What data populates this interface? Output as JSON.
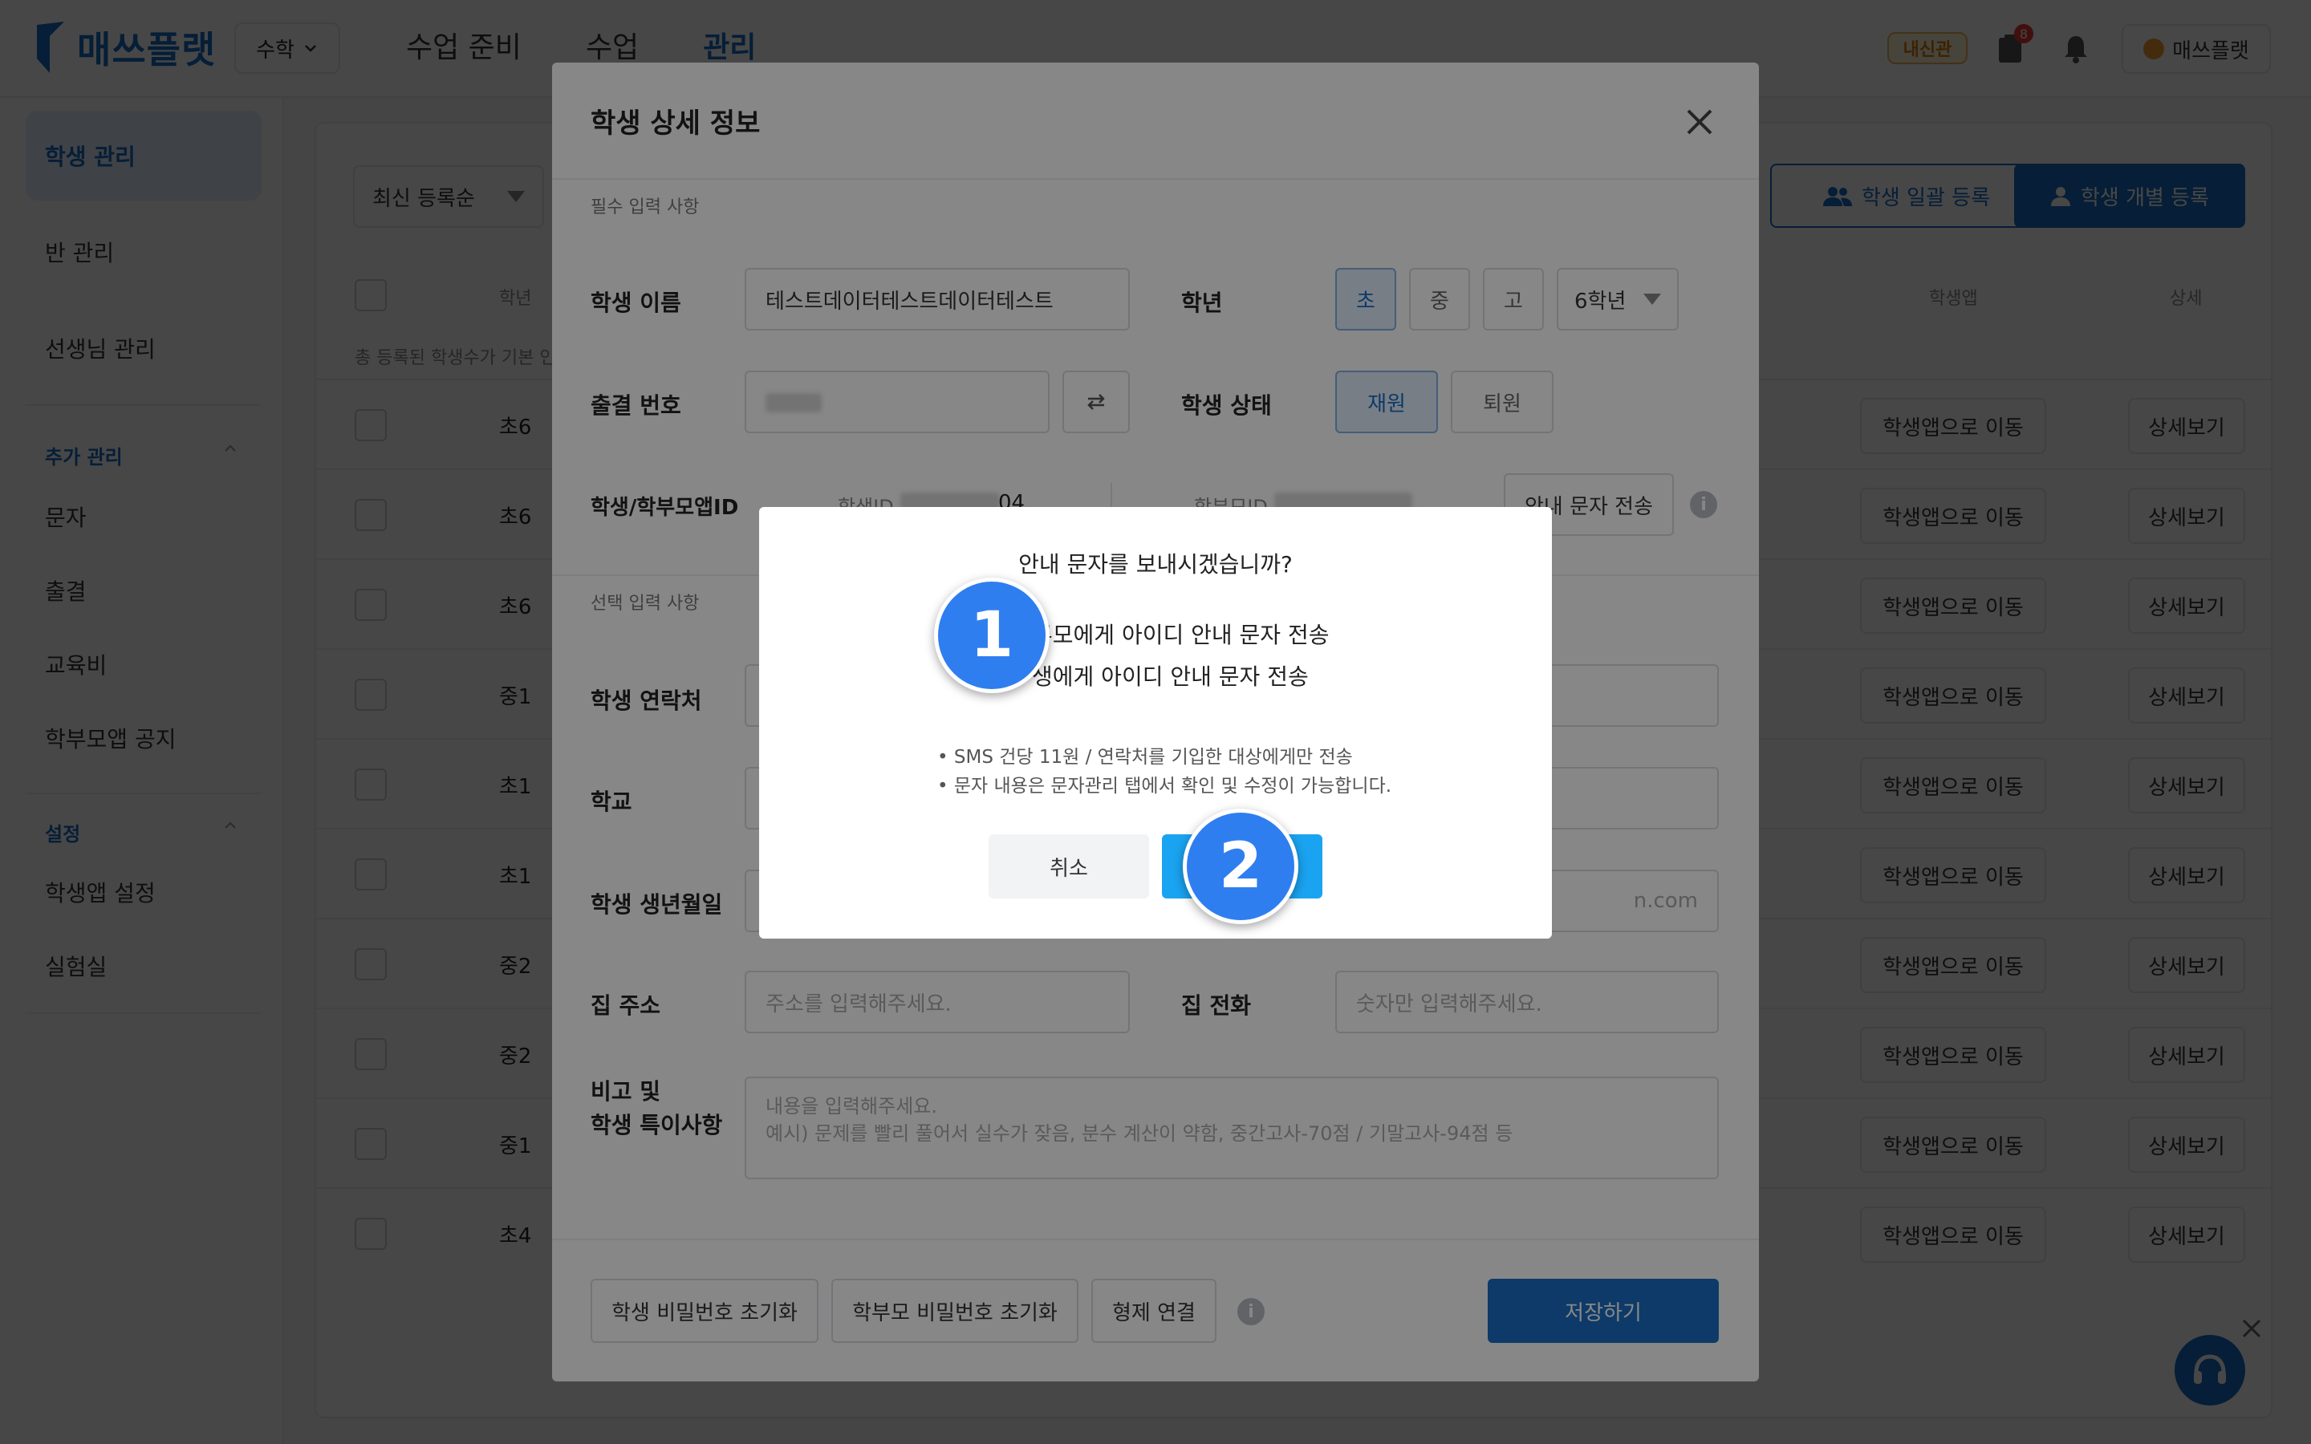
{
  "header": {
    "brand": "매쓰플랫",
    "subject": "수학",
    "nav": [
      "수업 준비",
      "수업",
      "관리"
    ],
    "badge": "내신관",
    "notif_count": "8",
    "user": "매쓰플랫"
  },
  "sidebar": {
    "items": [
      "학생 관리",
      "반 관리",
      "선생님 관리"
    ],
    "sec_extra": "추가 관리",
    "extra_items": [
      "문자",
      "출결",
      "교육비",
      "학부모앱 공지"
    ],
    "sec_settings": "설정",
    "settings_items": [
      "학생앱 설정",
      "실험실"
    ]
  },
  "list": {
    "sort": "최신 등록순",
    "bulk_register": "학생 일괄 등록",
    "single_register": "학생 개별 등록",
    "col_grade": "학년",
    "col_app": "학생앱",
    "col_detail": "상세",
    "note": "총 등록된 학생수가 기본 인",
    "rows": [
      {
        "grade": "초6",
        "app": "학생앱으로 이동",
        "detail": "상세보기"
      },
      {
        "grade": "초6",
        "app": "학생앱으로 이동",
        "detail": "상세보기"
      },
      {
        "grade": "초6",
        "app": "학생앱으로 이동",
        "detail": "상세보기"
      },
      {
        "grade": "중1",
        "app": "학생앱으로 이동",
        "detail": "상세보기"
      },
      {
        "grade": "초1",
        "app": "학생앱으로 이동",
        "detail": "상세보기"
      },
      {
        "grade": "초1",
        "app": "학생앱으로 이동",
        "detail": "상세보기"
      },
      {
        "grade": "중2",
        "app": "학생앱으로 이동",
        "detail": "상세보기"
      },
      {
        "grade": "중2",
        "app": "학생앱으로 이동",
        "detail": "상세보기"
      },
      {
        "grade": "중1",
        "app": "학생앱으로 이동",
        "detail": "상세보기"
      },
      {
        "grade": "초4",
        "app": "학생앱으로 이동",
        "detail": "상세보기"
      }
    ]
  },
  "modal": {
    "title": "학생 상세 정보",
    "required_label": "필수 입력 사항",
    "name_label": "학생 이름",
    "name_value": "테스트데이터테스트데이터테스트",
    "grade_label": "학년",
    "grade_options": [
      "초",
      "중",
      "고"
    ],
    "grade_year": "6학년",
    "attend_label": "출결 번호",
    "status_label": "학생 상태",
    "status_options": [
      "재원",
      "퇴원"
    ],
    "ids_label": "학생/학부모앱ID",
    "student_id_prefix": "학생ID",
    "student_id_suffix": "04",
    "parent_id_prefix": "학부모ID",
    "send_guide": "안내 문자 전송",
    "optional_label": "선택 입력 사항",
    "contact_label": "학생 연락처",
    "school_label": "학교",
    "birth_label": "학생 생년월일",
    "email_tail": "n.com",
    "address_label": "집 주소",
    "address_ph": "주소를 입력해주세요.",
    "phone_label": "집 전화",
    "phone_ph": "숫자만 입력해주세요.",
    "memo_label_1": "비고 및",
    "memo_label_2": "학생 특이사항",
    "memo_ph_1": "내용을 입력해주세요.",
    "memo_ph_2": "예시) 문제를 빨리 풀어서 실수가 잦음, 분수 계산이 약함, 중간고사-70점 / 기말고사-94점 등",
    "reset_student_pw": "학생 비밀번호 초기화",
    "reset_parent_pw": "학부모 비밀번호 초기화",
    "link_sibling": "형제 연결",
    "save": "저장하기"
  },
  "confirm": {
    "title": "안내 문자를 보내시겠습니까?",
    "line1": "부모에게 아이디 안내 문자 전송",
    "line2": "생에게 아이디 안내 문자 전송",
    "note1": "• SMS 건당 11원 / 연락처를 기입한 대상에게만 전송",
    "note2": "• 문자 내용은 문자관리 탭에서 확인 및 수정이 가능합니다.",
    "cancel": "취소",
    "send": ""
  },
  "markers": [
    "1",
    "2"
  ],
  "colors": {
    "primary": "#1a6fc4",
    "send": "#1aa3f0",
    "marker": "#2f7ef0"
  }
}
